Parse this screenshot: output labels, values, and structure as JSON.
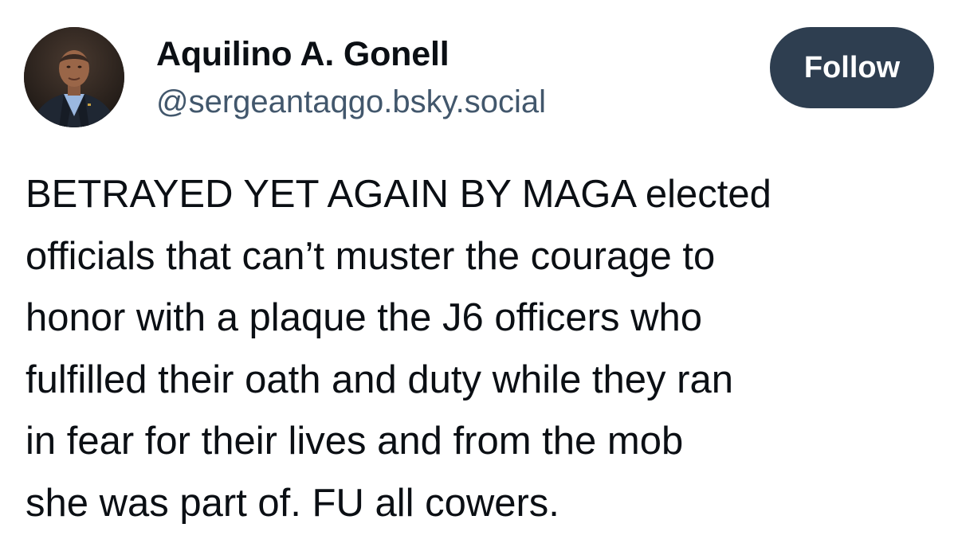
{
  "author": {
    "display_name": "Aquilino A. Gonell",
    "handle": "@sergeantaqgo.bsky.social",
    "avatar_icon": "profile-photo-icon"
  },
  "actions": {
    "follow_label": "Follow"
  },
  "post": {
    "lines": [
      "BETRAYED YET AGAIN BY MAGA elected",
      "officials that can’t muster the courage to",
      "honor with a plaque the J6 officers who",
      "fulfilled their oath and duty while they ran",
      "in fear for their lives and from the mob",
      "she was part of. FU all cowers."
    ]
  },
  "colors": {
    "follow_button_bg": "#2e3e50",
    "handle_text": "#42576c",
    "body_text": "#0b0f14"
  }
}
